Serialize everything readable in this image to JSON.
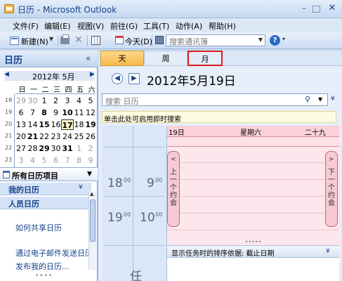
{
  "window": {
    "title": "日历 - Microsoft Outlook",
    "minimize": "–",
    "close": "✕"
  },
  "menu": [
    "文件(F)",
    "编辑(E)",
    "视图(V)",
    "前往(G)",
    "工具(T)",
    "动作(A)",
    "帮助(H)"
  ],
  "toolbar": {
    "new_label": "新建(N)",
    "today_label": "今天(D)",
    "search_contacts_placeholder": "搜索通讯簿",
    "help": "?"
  },
  "nav": {
    "title": "日历",
    "collapse": "«",
    "mini_calendar": {
      "title": "2012年 5月",
      "prev": "◀",
      "next": "▶",
      "weekdays": [
        "日",
        "一",
        "二",
        "三",
        "四",
        "五",
        "六"
      ],
      "weeks": [
        {
          "week": "18",
          "days": [
            {
              "d": "29",
              "gray": true
            },
            {
              "d": "30",
              "gray": true
            },
            {
              "d": "1"
            },
            {
              "d": "2"
            },
            {
              "d": "3"
            },
            {
              "d": "4"
            },
            {
              "d": "5"
            }
          ]
        },
        {
          "week": "19",
          "days": [
            {
              "d": "6"
            },
            {
              "d": "7"
            },
            {
              "d": "8",
              "bold": true
            },
            {
              "d": "9"
            },
            {
              "d": "10",
              "bold": true
            },
            {
              "d": "11"
            },
            {
              "d": "12"
            }
          ]
        },
        {
          "week": "20",
          "days": [
            {
              "d": "13"
            },
            {
              "d": "14"
            },
            {
              "d": "15",
              "bold": true
            },
            {
              "d": "16"
            },
            {
              "d": "17",
              "bold": true
            },
            {
              "d": "18"
            },
            {
              "d": "19",
              "bold": true
            }
          ]
        },
        {
          "week": "21",
          "days": [
            {
              "d": "20"
            },
            {
              "d": "21",
              "bold": true
            },
            {
              "d": "22"
            },
            {
              "d": "23"
            },
            {
              "d": "24"
            },
            {
              "d": "25"
            },
            {
              "d": "26"
            }
          ]
        },
        {
          "week": "22",
          "days": [
            {
              "d": "27"
            },
            {
              "d": "28"
            },
            {
              "d": "29",
              "bold": true
            },
            {
              "d": "30"
            },
            {
              "d": "31",
              "bold": true
            },
            {
              "d": "1",
              "gray": true
            },
            {
              "d": "2",
              "gray": true
            }
          ]
        },
        {
          "week": "23",
          "days": [
            {
              "d": "3",
              "gray": true
            },
            {
              "d": "4",
              "gray": true
            },
            {
              "d": "5",
              "gray": true
            },
            {
              "d": "6",
              "gray": true
            },
            {
              "d": "7",
              "gray": true
            },
            {
              "d": "8",
              "gray": true
            },
            {
              "d": "9",
              "gray": true
            }
          ]
        }
      ],
      "selected": "17"
    },
    "all_calendars": "所有日历项目",
    "my_calendars": "我的日历",
    "people_calendars": "人员日历",
    "links": [
      "如何共享日历",
      "通过电子邮件发送日历",
      "发布我的日历..."
    ]
  },
  "main": {
    "tabs": [
      "天",
      "周",
      "月"
    ],
    "date_heading": "2012年5月19日",
    "search_placeholder": "搜索 日历",
    "instant_search_hint": "单击此处可启用即时搜索",
    "day": {
      "number": "19日",
      "weekday": "星期六",
      "month_day": "二十九"
    },
    "time_labels": [
      {
        "hour": "18",
        "min": "00"
      },
      {
        "hour": "9",
        "min": "00"
      },
      {
        "hour": "19",
        "min": "00"
      },
      {
        "hour": "10",
        "min": "00"
      }
    ],
    "prev_appointment": "上一个约会",
    "next_appointment": "下一个约会",
    "task_header": "显示任务时的排序依据: 截止日期",
    "task_label": "任"
  },
  "colors": {
    "accent": "#15428b",
    "active_tab": "#f6b84a",
    "day_header": "#fbd0d8",
    "highlight_box": "#d82020"
  }
}
